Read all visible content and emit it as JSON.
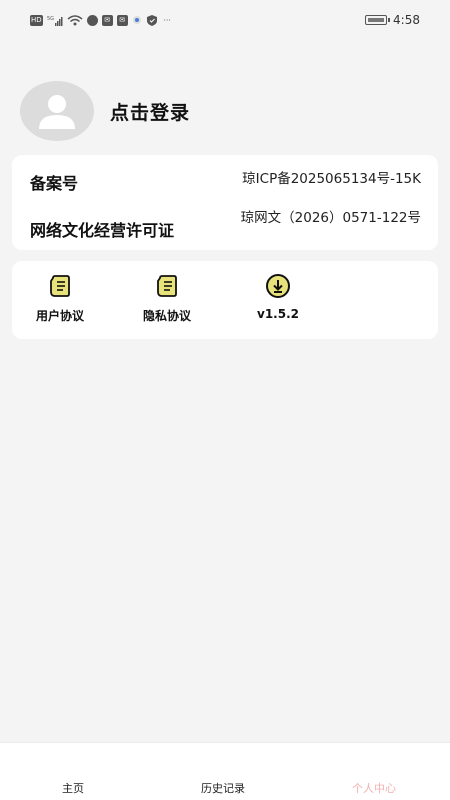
{
  "status_bar": {
    "icons": [
      "HD",
      "5G",
      "signal",
      "wifi",
      "app",
      "mail",
      "mail",
      "app",
      "shield",
      "..."
    ],
    "time": "4:58"
  },
  "profile": {
    "login_label": "点击登录"
  },
  "info_card": {
    "rows": [
      {
        "label": "备案号",
        "value": "琼ICP备2025065134号-15K"
      },
      {
        "label": "网络文化经营许可证",
        "value": "琼网文（2026）0571-122号"
      }
    ]
  },
  "links_card": {
    "items": [
      {
        "label": "用户协议",
        "icon": "document-icon"
      },
      {
        "label": "隐私协议",
        "icon": "document-icon"
      },
      {
        "label": "v1.5.2",
        "icon": "download-icon"
      }
    ]
  },
  "bottom_nav": {
    "items": [
      {
        "label": "主页"
      },
      {
        "label": "历史记录"
      },
      {
        "label": "个人中心"
      }
    ],
    "active_color": "#f3b0b0"
  }
}
